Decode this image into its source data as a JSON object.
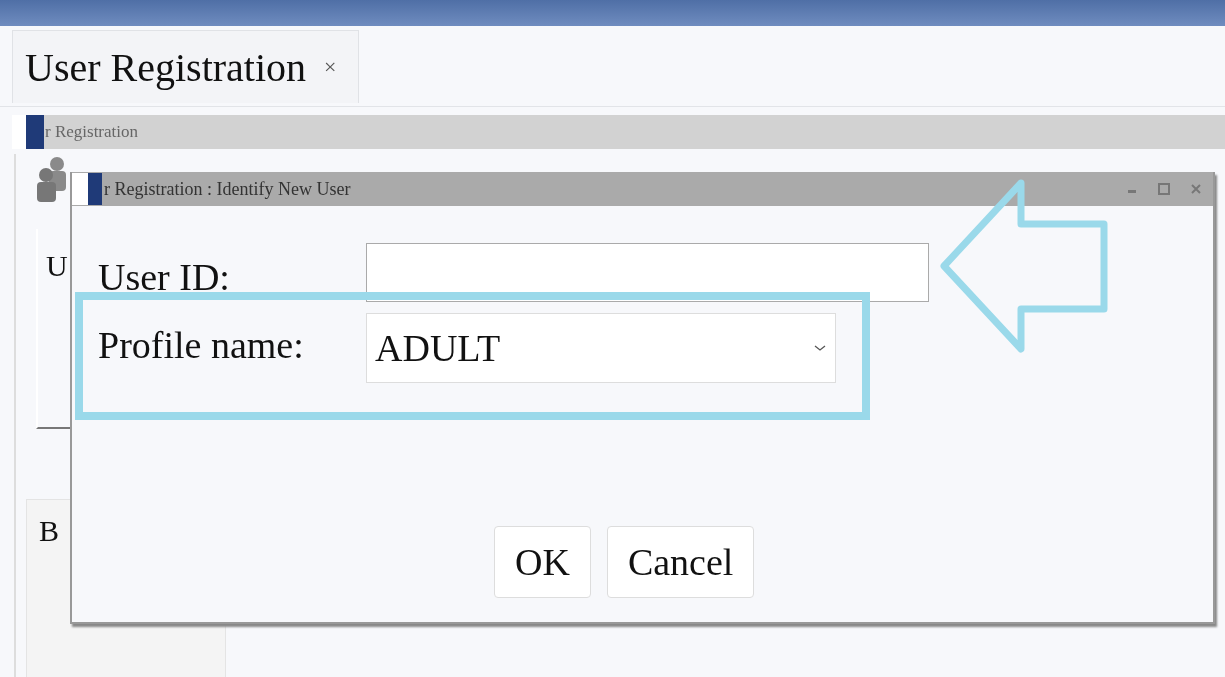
{
  "document_tab": {
    "title": "User Registration",
    "close": "×"
  },
  "section_bar": {
    "title": "r Registration"
  },
  "background_panels": [
    {
      "text": "U"
    },
    {
      "text": "B"
    }
  ],
  "dialog": {
    "title": "r Registration : Identify New User",
    "fields": [
      {
        "kind": "text",
        "label": "User ID:"
      },
      {
        "kind": "select",
        "label": "Profile name:",
        "value": "ADULT"
      }
    ],
    "buttons": [
      "OK",
      "Cancel"
    ]
  }
}
